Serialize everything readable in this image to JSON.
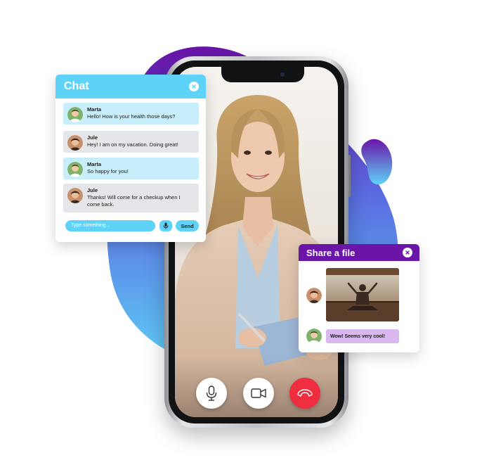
{
  "chat": {
    "title": "Chat",
    "messages": [
      {
        "name": "Marta",
        "text": "Hello! How is your health those days?",
        "style": "blue"
      },
      {
        "name": "Jule",
        "text": "Hey! I am on my vacation. Doing great!",
        "style": "gray"
      },
      {
        "name": "Marta",
        "text": "So happy for you!",
        "style": "blue"
      },
      {
        "name": "Jule",
        "text": "Thanks! Will come for a checkup when I come back.",
        "style": "gray"
      }
    ],
    "input_placeholder": "Type something...",
    "send_label": "Send"
  },
  "share": {
    "title": "Share a file",
    "reply": "Wow! Seems very cool!"
  },
  "call_controls": [
    {
      "icon": "microphone-icon"
    },
    {
      "icon": "video-camera-icon"
    },
    {
      "icon": "end-call-icon"
    }
  ],
  "colors": {
    "chat_accent": "#5fd3f7",
    "share_accent": "#6a14a8",
    "end_call": "#ee2d3f",
    "blob_gradient": [
      "#6a14a8",
      "#5fd3f7"
    ]
  }
}
